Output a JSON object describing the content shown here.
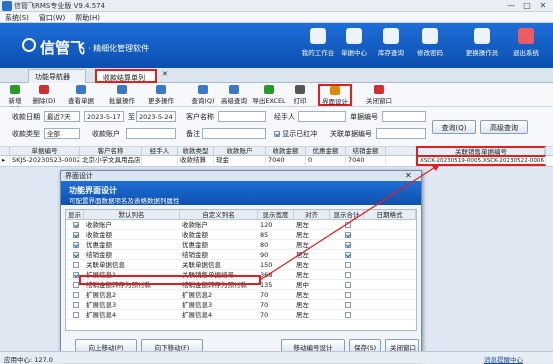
{
  "window": {
    "title": "信管飞RMS专业版 V9.4.574",
    "min": "—",
    "max": "□",
    "close": "✕"
  },
  "menu": [
    "系统(S)",
    "窗口(W)",
    "帮助(H)"
  ],
  "banner": {
    "brand": "信管飞",
    "slogan": "· 精细化管理软件"
  },
  "nav": [
    {
      "label": "我的工作台",
      "icon": "workbench-icon",
      "color": "#ffffff"
    },
    {
      "label": "单据中心",
      "icon": "documents-icon",
      "color": "#ffffff"
    },
    {
      "label": "库存查询",
      "icon": "inventory-icon",
      "color": "#ffffff"
    },
    {
      "label": "修改密码",
      "icon": "key-icon",
      "color": "#ffffff"
    },
    {
      "label": "更换操作员",
      "icon": "user-switch-icon",
      "color": "#ffffff"
    },
    {
      "label": "退出系统",
      "icon": "power-icon",
      "color": "#ffffff"
    }
  ],
  "tabs": [
    {
      "label": "功能导航器"
    },
    {
      "label": "收款结算单列表",
      "close": "✕"
    }
  ],
  "toolbar": [
    {
      "label": "新增(N)",
      "color": "#2a9a2a"
    },
    {
      "label": "删除(D)",
      "color": "#d32f2f"
    },
    {
      "label": "查看单据",
      "color": "#3a78c8"
    },
    {
      "label": "批量操作",
      "color": "#3a78c8"
    },
    {
      "label": "更多操作",
      "color": "#3a78c8"
    },
    {
      "label": "查询(Q)",
      "color": "#3a78c8"
    },
    {
      "label": "高级查询",
      "color": "#3a78c8"
    },
    {
      "label": "导出EXCEL",
      "color": "#2a9a2a"
    },
    {
      "label": "打印",
      "color": "#555555"
    },
    {
      "label": "界面设计",
      "color": "#e08a00"
    },
    {
      "label": "关闭窗口",
      "color": "#d32f2f"
    }
  ],
  "filter": {
    "date_label": "收款日期",
    "date_range": "最近7天",
    "date_from": "2023-5-17",
    "to_label": "至",
    "date_to": "2023-5-24",
    "customer_label": "客户名称",
    "handler_label": "经手人",
    "docno_label": "单据编号",
    "type_label": "收款类型",
    "type_value": "全部",
    "account_label": "收款账户",
    "remark_label": "备注",
    "show_voided": "显示已红冲",
    "related_label": "关联单据编号",
    "query_btn": "查询(Q)",
    "adv_btn": "高级查询"
  },
  "grid": {
    "headers": [
      "单据编号",
      "客户名称",
      "经手人",
      "收款类型",
      "收款账户",
      "收款金额",
      "优惠金额",
      "结销金额",
      "关联销售单据编号"
    ],
    "row": [
      "SKJS-20230523-0002",
      "北京小学文具用品店",
      "",
      "收款结算",
      "现金",
      "7040",
      "0",
      "7040",
      "XSCK-20230519-0005,XSCK-20230522-0006"
    ]
  },
  "dialog": {
    "title": "界面设计",
    "head_title": "功能界面设计",
    "head_sub": "可配置界面数据项名及表格数据列属性",
    "columns": [
      "显示",
      "默认列名",
      "自定义列名",
      "显示宽度",
      "对齐",
      "显示合计",
      "日期格式"
    ],
    "rows": [
      {
        "show": true,
        "default": "收款账户",
        "custom": "收款账户",
        "width": "120",
        "align": "居左",
        "total": false
      },
      {
        "show": true,
        "default": "收款金额",
        "custom": "收款金额",
        "width": "85",
        "align": "居左",
        "total": true
      },
      {
        "show": true,
        "default": "优惠金额",
        "custom": "优惠金额",
        "width": "80",
        "align": "居左",
        "total": true
      },
      {
        "show": true,
        "default": "结销金额",
        "custom": "结销金额",
        "width": "90",
        "align": "居左",
        "total": true
      },
      {
        "show": false,
        "default": "关联单据信息",
        "custom": "关联单据信息",
        "width": "150",
        "align": "居左",
        "total": false
      },
      {
        "show": true,
        "default": "扩展信息1",
        "custom": "关联销售单据编号",
        "width": "368",
        "align": "居左",
        "total": false
      },
      {
        "show": false,
        "default": "结销金额转存为预付款",
        "custom": "结销金额转存为预付款",
        "width": "135",
        "align": "居中",
        "total": false
      },
      {
        "show": false,
        "default": "扩展信息2",
        "custom": "扩展信息2",
        "width": "70",
        "align": "居左",
        "total": false
      },
      {
        "show": false,
        "default": "扩展信息3",
        "custom": "扩展信息3",
        "width": "70",
        "align": "居左",
        "total": false
      },
      {
        "show": false,
        "default": "扩展信息4",
        "custom": "扩展信息4",
        "width": "70",
        "align": "居左",
        "total": false
      }
    ],
    "btn_up": "向上移动(P)",
    "btn_down": "向下移动(F)",
    "btn_move": "移动编号设计",
    "btn_save": "保存(S)",
    "btn_close": "关闭窗口"
  },
  "status": {
    "left": "应用中心: 127.0",
    "right": "消息提醒中心"
  }
}
